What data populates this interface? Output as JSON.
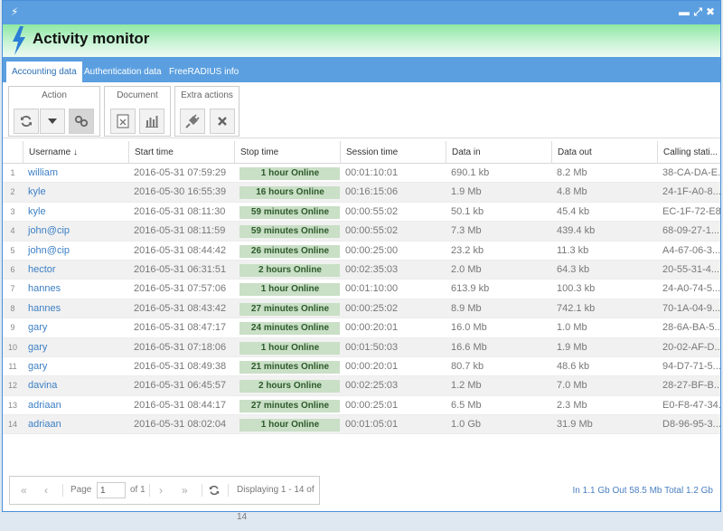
{
  "app": {
    "title": "Activity monitor",
    "window_controls": {
      "minimize": "▬",
      "maximize": "⤢",
      "close": "✖"
    }
  },
  "tabs": [
    {
      "label": "Accounting data",
      "active": true
    },
    {
      "label": "Authentication data",
      "active": false
    },
    {
      "label": "FreeRADIUS info",
      "active": false
    }
  ],
  "toolbar": {
    "action": {
      "label": "Action",
      "buttons": [
        "refresh-icon",
        "dropdown-arrow-icon",
        "link-icon"
      ]
    },
    "document": {
      "label": "Document",
      "buttons": [
        "excel-export-icon",
        "bar-chart-icon"
      ]
    },
    "extra": {
      "label": "Extra actions",
      "buttons": [
        "plug-icon",
        "remove-icon"
      ]
    }
  },
  "grid": {
    "columns": [
      "",
      "Username ↓",
      "Start time",
      "Stop time",
      "Session time",
      "Data in",
      "Data out",
      "Calling stati..."
    ],
    "rows": [
      {
        "n": "1",
        "username": "william",
        "start": "2016-05-31 07:59:29",
        "stop": "1 hour Online",
        "session": "00:01:10:01",
        "in": "690.1 kb",
        "out": "8.2 Mb",
        "calling": "38-CA-DA-E..."
      },
      {
        "n": "2",
        "username": "kyle",
        "start": "2016-05-30 16:55:39",
        "stop": "16 hours Online",
        "session": "00:16:15:06",
        "in": "1.9 Mb",
        "out": "4.8 Mb",
        "calling": "24-1F-A0-8..."
      },
      {
        "n": "3",
        "username": "kyle",
        "start": "2016-05-31 08:11:30",
        "stop": "59 minutes Online",
        "session": "00:00:55:02",
        "in": "50.1 kb",
        "out": "45.4 kb",
        "calling": "EC-1F-72-E8..."
      },
      {
        "n": "4",
        "username": "john@cip",
        "start": "2016-05-31 08:11:59",
        "stop": "59 minutes Online",
        "session": "00:00:55:02",
        "in": "7.3 Mb",
        "out": "439.4 kb",
        "calling": "68-09-27-1..."
      },
      {
        "n": "5",
        "username": "john@cip",
        "start": "2016-05-31 08:44:42",
        "stop": "26 minutes Online",
        "session": "00:00:25:00",
        "in": "23.2 kb",
        "out": "11.3 kb",
        "calling": "A4-67-06-3..."
      },
      {
        "n": "6",
        "username": "hector",
        "start": "2016-05-31 06:31:51",
        "stop": "2 hours Online",
        "session": "00:02:35:03",
        "in": "2.0 Mb",
        "out": "64.3 kb",
        "calling": "20-55-31-4..."
      },
      {
        "n": "7",
        "username": "hannes",
        "start": "2016-05-31 07:57:06",
        "stop": "1 hour Online",
        "session": "00:01:10:00",
        "in": "613.9 kb",
        "out": "100.3 kb",
        "calling": "24-A0-74-5..."
      },
      {
        "n": "8",
        "username": "hannes",
        "start": "2016-05-31 08:43:42",
        "stop": "27 minutes Online",
        "session": "00:00:25:02",
        "in": "8.9 Mb",
        "out": "742.1 kb",
        "calling": "70-1A-04-9..."
      },
      {
        "n": "9",
        "username": "gary",
        "start": "2016-05-31 08:47:17",
        "stop": "24 minutes Online",
        "session": "00:00:20:01",
        "in": "16.0 Mb",
        "out": "1.0 Mb",
        "calling": "28-6A-BA-5..."
      },
      {
        "n": "10",
        "username": "gary",
        "start": "2016-05-31 07:18:06",
        "stop": "1 hour Online",
        "session": "00:01:50:03",
        "in": "16.6 Mb",
        "out": "1.9 Mb",
        "calling": "20-02-AF-D..."
      },
      {
        "n": "11",
        "username": "gary",
        "start": "2016-05-31 08:49:38",
        "stop": "21 minutes Online",
        "session": "00:00:20:01",
        "in": "80.7 kb",
        "out": "48.6 kb",
        "calling": "94-D7-71-5..."
      },
      {
        "n": "12",
        "username": "davina",
        "start": "2016-05-31 06:45:57",
        "stop": "2 hours Online",
        "session": "00:02:25:03",
        "in": "1.2 Mb",
        "out": "7.0 Mb",
        "calling": "28-27-BF-B..."
      },
      {
        "n": "13",
        "username": "adriaan",
        "start": "2016-05-31 08:44:17",
        "stop": "27 minutes Online",
        "session": "00:00:25:01",
        "in": "6.5 Mb",
        "out": "2.3 Mb",
        "calling": "E0-F8-47-34..."
      },
      {
        "n": "14",
        "username": "adriaan",
        "start": "2016-05-31 08:02:04",
        "stop": "1 hour Online",
        "session": "00:01:05:01",
        "in": "1.0 Gb",
        "out": "31.9 Mb",
        "calling": "D8-96-95-3..."
      }
    ]
  },
  "pager": {
    "page_label": "Page",
    "page_value": "1",
    "of_label": "of 1",
    "displaying": "Displaying 1 - 14 of 14"
  },
  "traffic_summary": "In 1.1 Gb Out 58.5 Mb Total 1.2 Gb",
  "colors": {
    "accent": "#5b9fe0",
    "header_green": "#8ee8a4",
    "online_pill": "#c9dfc6",
    "link": "#3c7fc4"
  }
}
